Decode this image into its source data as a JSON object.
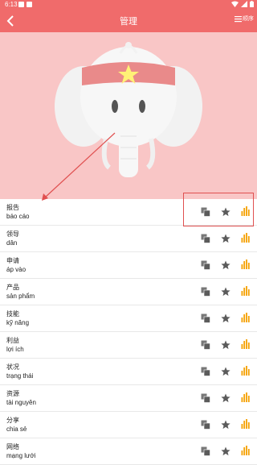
{
  "status_bar": {
    "time": "6:13"
  },
  "app_bar": {
    "title": "管理",
    "sort_label": "顺序"
  },
  "colors": {
    "brand": "#f06b6b",
    "hero_bg": "#f9c6c6",
    "accent": "#f5a000",
    "icon_gray": "#5b5b5b"
  },
  "words": [
    {
      "word": "报告",
      "pron": "báo cáo"
    },
    {
      "word": "领导",
      "pron": "dân"
    },
    {
      "word": "申请",
      "pron": "áp vào"
    },
    {
      "word": "产品",
      "pron": "sản phẩm"
    },
    {
      "word": "技能",
      "pron": "kỹ năng"
    },
    {
      "word": "利益",
      "pron": "lợi ích"
    },
    {
      "word": "状况",
      "pron": "trạng thái"
    },
    {
      "word": "资源",
      "pron": "tài nguyên"
    },
    {
      "word": "分享",
      "pron": "chia sẻ"
    },
    {
      "word": "网络",
      "pron": "mạng lưới"
    }
  ]
}
